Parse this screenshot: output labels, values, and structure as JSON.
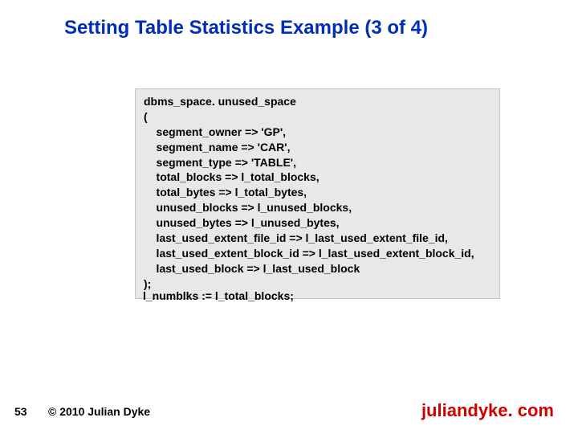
{
  "slide": {
    "title": "Setting Table Statistics\nExample (3 of 4)",
    "code": "dbms_space. unused_space\n(\n    segment_owner => 'GP',\n    segment_name => 'CAR',\n    segment_type => 'TABLE',\n    total_blocks => l_total_blocks,\n    total_bytes => l_total_bytes,\n    unused_blocks => l_unused_blocks,\n    unused_bytes => l_unused_bytes,\n    last_used_extent_file_id => l_last_used_extent_file_id,\n    last_used_extent_block_id => l_last_used_extent_block_id,\n    last_used_block => l_last_used_block\n);",
    "post_code": "l_numblks := l_total_blocks;",
    "page_number": "53",
    "copyright": "© 2010 Julian Dyke",
    "site": "juliandyke. com"
  }
}
